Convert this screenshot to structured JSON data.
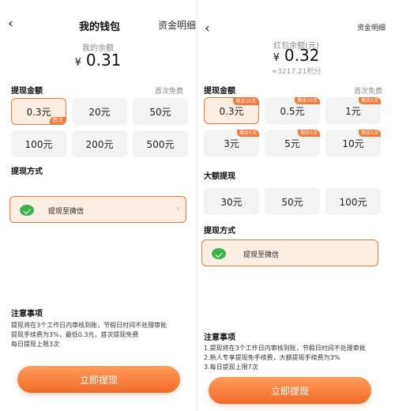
{
  "left": {
    "header": {
      "title": "我的钱包",
      "link": "资金明细"
    },
    "balance": {
      "label": "我的余额",
      "currency": "¥",
      "value": "0.31"
    },
    "amount_section": {
      "title": "提现金额",
      "note": "首次免费"
    },
    "options": [
      {
        "label": "0.3元",
        "badge": "首次",
        "selected": true
      },
      {
        "label": "20元"
      },
      {
        "label": "50元"
      },
      {
        "label": "100元"
      },
      {
        "label": "200元"
      },
      {
        "label": "500元"
      }
    ],
    "method_section": {
      "title": "提现方式",
      "method_label": "提现至微信"
    },
    "notes": {
      "title": "注意事项",
      "line1": "提现将在3个工作日内审核到账，节假日时间不处理审批",
      "line2": "提现手续费为3%，最低0.3元，首次提现免费",
      "line3": "每日提现上限3次"
    },
    "cta_label": "立即提现"
  },
  "right": {
    "header": {
      "link": "资金明细"
    },
    "balance": {
      "label": "红包余额(元)",
      "currency": "¥",
      "value": "0.32",
      "sub": "≈3217.21积分"
    },
    "amount_section": {
      "title": "提现金额",
      "note": "首次免费"
    },
    "options": [
      {
        "label": "0.3元",
        "badge": "剩余10次",
        "selected": true
      },
      {
        "label": "0.5元",
        "badge": "剩余10次"
      },
      {
        "label": "1元",
        "badge": "剩余5次"
      },
      {
        "label": "3元",
        "badge": "剩余5次"
      },
      {
        "label": "5元",
        "badge": "剩余5次"
      },
      {
        "label": "10元",
        "badge": "剩余5次"
      }
    ],
    "large_section": {
      "title": "大额提现"
    },
    "large_options": [
      {
        "label": "30元"
      },
      {
        "label": "50元"
      },
      {
        "label": "100元"
      }
    ],
    "method_section": {
      "title": "提现方式",
      "method_label": "提现至微信"
    },
    "notes": {
      "title": "注意事项",
      "line1": "1.提现将在3个工作日内审核到账，节假日时间不处理审批",
      "line2": "2.新人专享提现免手续费，大额提现手续费为3%",
      "line3": "3.每日提现上限7次"
    },
    "cta_label": "立即提现"
  },
  "colors": {
    "accent": "#f07a3a",
    "selected_bg": "#fdeee3",
    "option_bg": "#f3f3f3",
    "wechat": "#3bb34a"
  },
  "icons": {
    "back": "chevron-left-icon",
    "wechat": "wechat-icon",
    "arrow": "chevron-right-icon"
  }
}
